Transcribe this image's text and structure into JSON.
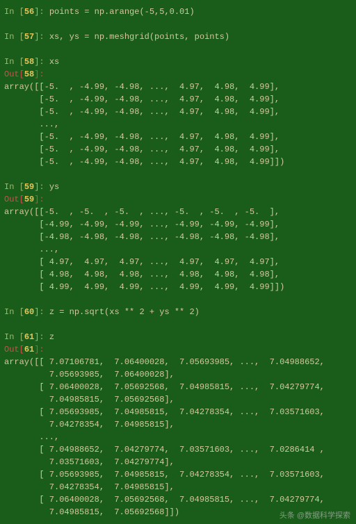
{
  "cells": [
    {
      "n": "56",
      "in": "points = np.arange(-5,5,0.01)"
    },
    {
      "n": "57",
      "in": "xs, ys = np.meshgrid(points, points)"
    },
    {
      "n": "58",
      "in": "xs",
      "out": [
        "array([[-5.  , -4.99, -4.98, ...,  4.97,  4.98,  4.99],",
        "       [-5.  , -4.99, -4.98, ...,  4.97,  4.98,  4.99],",
        "       [-5.  , -4.99, -4.98, ...,  4.97,  4.98,  4.99],",
        "       ...,",
        "       [-5.  , -4.99, -4.98, ...,  4.97,  4.98,  4.99],",
        "       [-5.  , -4.99, -4.98, ...,  4.97,  4.98,  4.99],",
        "       [-5.  , -4.99, -4.98, ...,  4.97,  4.98,  4.99]])"
      ]
    },
    {
      "n": "59",
      "in": "ys",
      "out": [
        "array([[-5.  , -5.  , -5.  , ..., -5.  , -5.  , -5.  ],",
        "       [-4.99, -4.99, -4.99, ..., -4.99, -4.99, -4.99],",
        "       [-4.98, -4.98, -4.98, ..., -4.98, -4.98, -4.98],",
        "       ...,",
        "       [ 4.97,  4.97,  4.97, ...,  4.97,  4.97,  4.97],",
        "       [ 4.98,  4.98,  4.98, ...,  4.98,  4.98,  4.98],",
        "       [ 4.99,  4.99,  4.99, ...,  4.99,  4.99,  4.99]])"
      ]
    },
    {
      "n": "60",
      "in": "z = np.sqrt(xs ** 2 + ys ** 2)"
    },
    {
      "n": "61",
      "in": "z",
      "out": [
        "array([[ 7.07106781,  7.06400028,  7.05693985, ...,  7.04988652,",
        "         7.05693985,  7.06400028],",
        "       [ 7.06400028,  7.05692568,  7.04985815, ...,  7.04279774,",
        "         7.04985815,  7.05692568],",
        "       [ 7.05693985,  7.04985815,  7.04278354, ...,  7.03571603,",
        "         7.04278354,  7.04985815],",
        "       ...,",
        "       [ 7.04988652,  7.04279774,  7.03571603, ...,  7.0286414 ,",
        "         7.03571603,  7.04279774],",
        "       [ 7.05693985,  7.04985815,  7.04278354, ...,  7.03571603,",
        "         7.04278354,  7.04985815],",
        "       [ 7.06400028,  7.05692568,  7.04985815, ...,  7.04279774,",
        "         7.04985815,  7.05692568]])"
      ]
    }
  ],
  "watermark": "头条 @数据科学探索"
}
